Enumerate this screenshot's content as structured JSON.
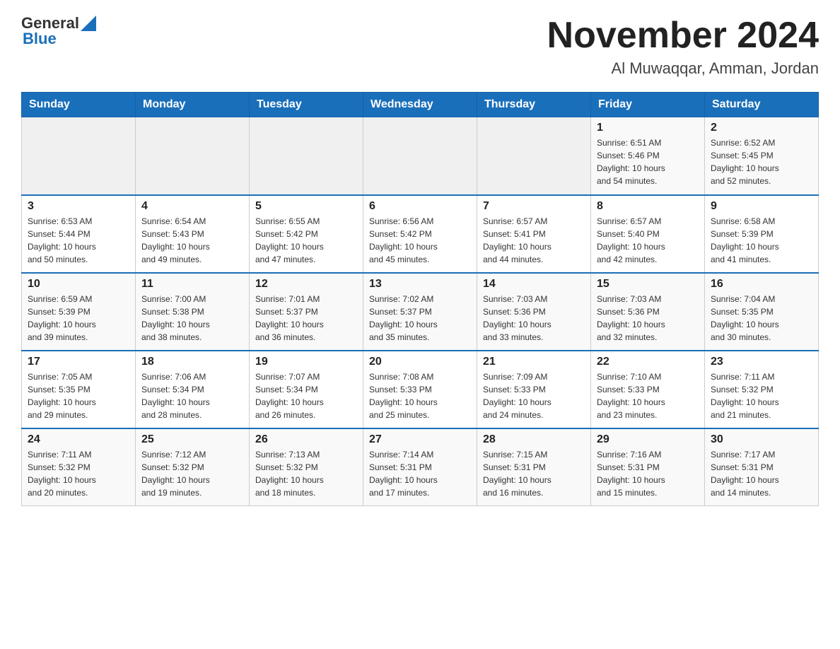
{
  "header": {
    "logo_general": "General",
    "logo_blue": "Blue",
    "month_title": "November 2024",
    "location": "Al Muwaqqar, Amman, Jordan"
  },
  "weekdays": [
    "Sunday",
    "Monday",
    "Tuesday",
    "Wednesday",
    "Thursday",
    "Friday",
    "Saturday"
  ],
  "weeks": [
    {
      "days": [
        {
          "num": "",
          "info": ""
        },
        {
          "num": "",
          "info": ""
        },
        {
          "num": "",
          "info": ""
        },
        {
          "num": "",
          "info": ""
        },
        {
          "num": "",
          "info": ""
        },
        {
          "num": "1",
          "info": "Sunrise: 6:51 AM\nSunset: 5:46 PM\nDaylight: 10 hours\nand 54 minutes."
        },
        {
          "num": "2",
          "info": "Sunrise: 6:52 AM\nSunset: 5:45 PM\nDaylight: 10 hours\nand 52 minutes."
        }
      ]
    },
    {
      "days": [
        {
          "num": "3",
          "info": "Sunrise: 6:53 AM\nSunset: 5:44 PM\nDaylight: 10 hours\nand 50 minutes."
        },
        {
          "num": "4",
          "info": "Sunrise: 6:54 AM\nSunset: 5:43 PM\nDaylight: 10 hours\nand 49 minutes."
        },
        {
          "num": "5",
          "info": "Sunrise: 6:55 AM\nSunset: 5:42 PM\nDaylight: 10 hours\nand 47 minutes."
        },
        {
          "num": "6",
          "info": "Sunrise: 6:56 AM\nSunset: 5:42 PM\nDaylight: 10 hours\nand 45 minutes."
        },
        {
          "num": "7",
          "info": "Sunrise: 6:57 AM\nSunset: 5:41 PM\nDaylight: 10 hours\nand 44 minutes."
        },
        {
          "num": "8",
          "info": "Sunrise: 6:57 AM\nSunset: 5:40 PM\nDaylight: 10 hours\nand 42 minutes."
        },
        {
          "num": "9",
          "info": "Sunrise: 6:58 AM\nSunset: 5:39 PM\nDaylight: 10 hours\nand 41 minutes."
        }
      ]
    },
    {
      "days": [
        {
          "num": "10",
          "info": "Sunrise: 6:59 AM\nSunset: 5:39 PM\nDaylight: 10 hours\nand 39 minutes."
        },
        {
          "num": "11",
          "info": "Sunrise: 7:00 AM\nSunset: 5:38 PM\nDaylight: 10 hours\nand 38 minutes."
        },
        {
          "num": "12",
          "info": "Sunrise: 7:01 AM\nSunset: 5:37 PM\nDaylight: 10 hours\nand 36 minutes."
        },
        {
          "num": "13",
          "info": "Sunrise: 7:02 AM\nSunset: 5:37 PM\nDaylight: 10 hours\nand 35 minutes."
        },
        {
          "num": "14",
          "info": "Sunrise: 7:03 AM\nSunset: 5:36 PM\nDaylight: 10 hours\nand 33 minutes."
        },
        {
          "num": "15",
          "info": "Sunrise: 7:03 AM\nSunset: 5:36 PM\nDaylight: 10 hours\nand 32 minutes."
        },
        {
          "num": "16",
          "info": "Sunrise: 7:04 AM\nSunset: 5:35 PM\nDaylight: 10 hours\nand 30 minutes."
        }
      ]
    },
    {
      "days": [
        {
          "num": "17",
          "info": "Sunrise: 7:05 AM\nSunset: 5:35 PM\nDaylight: 10 hours\nand 29 minutes."
        },
        {
          "num": "18",
          "info": "Sunrise: 7:06 AM\nSunset: 5:34 PM\nDaylight: 10 hours\nand 28 minutes."
        },
        {
          "num": "19",
          "info": "Sunrise: 7:07 AM\nSunset: 5:34 PM\nDaylight: 10 hours\nand 26 minutes."
        },
        {
          "num": "20",
          "info": "Sunrise: 7:08 AM\nSunset: 5:33 PM\nDaylight: 10 hours\nand 25 minutes."
        },
        {
          "num": "21",
          "info": "Sunrise: 7:09 AM\nSunset: 5:33 PM\nDaylight: 10 hours\nand 24 minutes."
        },
        {
          "num": "22",
          "info": "Sunrise: 7:10 AM\nSunset: 5:33 PM\nDaylight: 10 hours\nand 23 minutes."
        },
        {
          "num": "23",
          "info": "Sunrise: 7:11 AM\nSunset: 5:32 PM\nDaylight: 10 hours\nand 21 minutes."
        }
      ]
    },
    {
      "days": [
        {
          "num": "24",
          "info": "Sunrise: 7:11 AM\nSunset: 5:32 PM\nDaylight: 10 hours\nand 20 minutes."
        },
        {
          "num": "25",
          "info": "Sunrise: 7:12 AM\nSunset: 5:32 PM\nDaylight: 10 hours\nand 19 minutes."
        },
        {
          "num": "26",
          "info": "Sunrise: 7:13 AM\nSunset: 5:32 PM\nDaylight: 10 hours\nand 18 minutes."
        },
        {
          "num": "27",
          "info": "Sunrise: 7:14 AM\nSunset: 5:31 PM\nDaylight: 10 hours\nand 17 minutes."
        },
        {
          "num": "28",
          "info": "Sunrise: 7:15 AM\nSunset: 5:31 PM\nDaylight: 10 hours\nand 16 minutes."
        },
        {
          "num": "29",
          "info": "Sunrise: 7:16 AM\nSunset: 5:31 PM\nDaylight: 10 hours\nand 15 minutes."
        },
        {
          "num": "30",
          "info": "Sunrise: 7:17 AM\nSunset: 5:31 PM\nDaylight: 10 hours\nand 14 minutes."
        }
      ]
    }
  ]
}
